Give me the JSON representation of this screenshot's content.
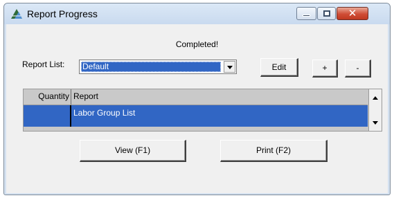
{
  "window": {
    "title": "Report Progress",
    "icon": "app-triangle-logo-icon",
    "controls": {
      "minimize": "minimize-icon",
      "maximize": "maximize-icon",
      "close": "✕"
    }
  },
  "status_text": "Completed!",
  "report_list": {
    "label": "Report List:",
    "selected": "Default"
  },
  "buttons": {
    "edit": "Edit",
    "add": "+",
    "remove": "-",
    "view": "View (F1)",
    "print": "Print (F2)"
  },
  "grid": {
    "columns": [
      "Quantity",
      "Report"
    ],
    "rows": [
      {
        "quantity": "",
        "report": "Labor Group List"
      }
    ]
  },
  "colors": {
    "selection": "#3166c4",
    "window_frame": "#d4e1f0",
    "close_button": "#c0391f"
  }
}
